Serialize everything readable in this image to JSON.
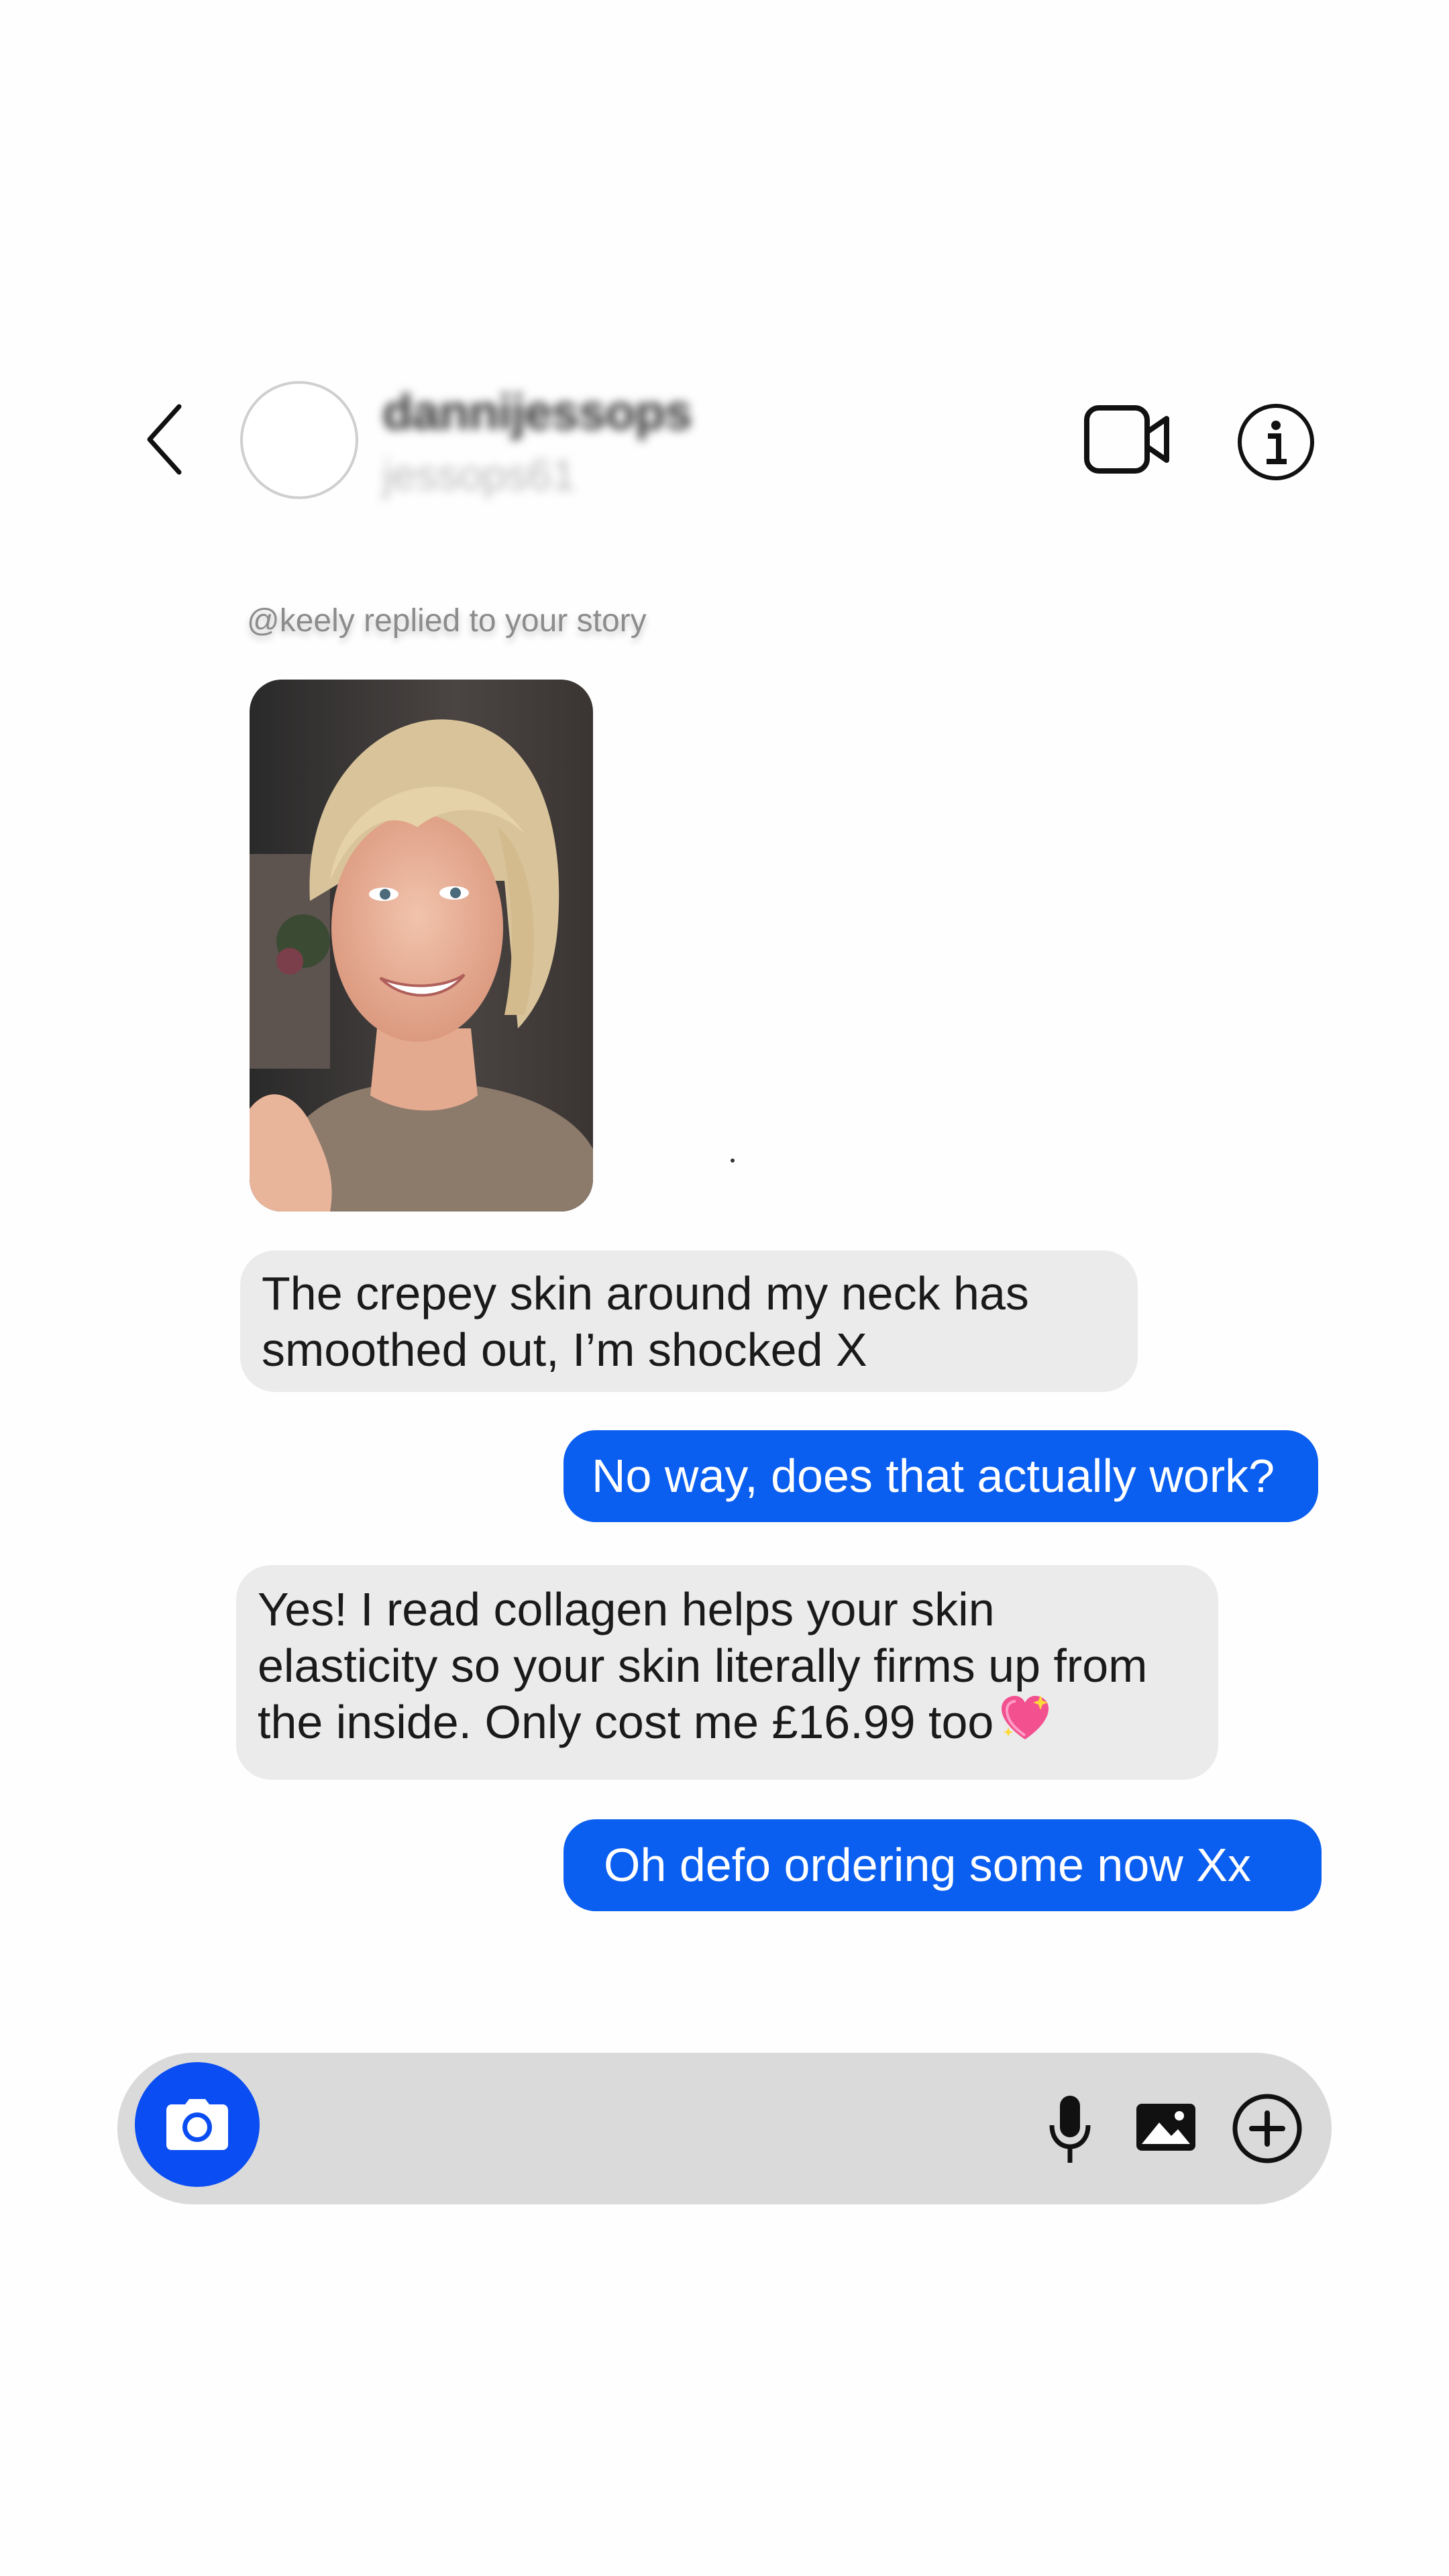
{
  "header": {
    "display_name": "dannijessops",
    "username": "jessops61",
    "icons": {
      "back": "chevron-left-icon",
      "video": "video-camera-icon",
      "info": "info-icon"
    }
  },
  "story": {
    "reply_note": "@keely replied to your story"
  },
  "messages": [
    {
      "direction": "incoming",
      "lines": [
        "The crepey skin around my neck has",
        "smoothed out, I’m shocked X"
      ]
    },
    {
      "direction": "outgoing",
      "text": "No way, does that actually work?"
    },
    {
      "direction": "incoming",
      "lines": [
        "Yes! I read collagen helps your skin",
        "elasticity so your skin literally firms up from",
        "the inside. Only cost me £16.99 too"
      ]
    },
    {
      "direction": "outgoing",
      "text": "Oh defo ordering some now Xx"
    }
  ],
  "composer": {
    "icons": [
      "camera-icon",
      "microphone-icon",
      "gallery-icon",
      "plus-circle-icon"
    ]
  },
  "colors": {
    "outgoing_bubble": "#0a5ef0",
    "incoming_bubble": "#ebebeb",
    "camera_button": "#0a4df2",
    "composer_background": "#dadada"
  }
}
